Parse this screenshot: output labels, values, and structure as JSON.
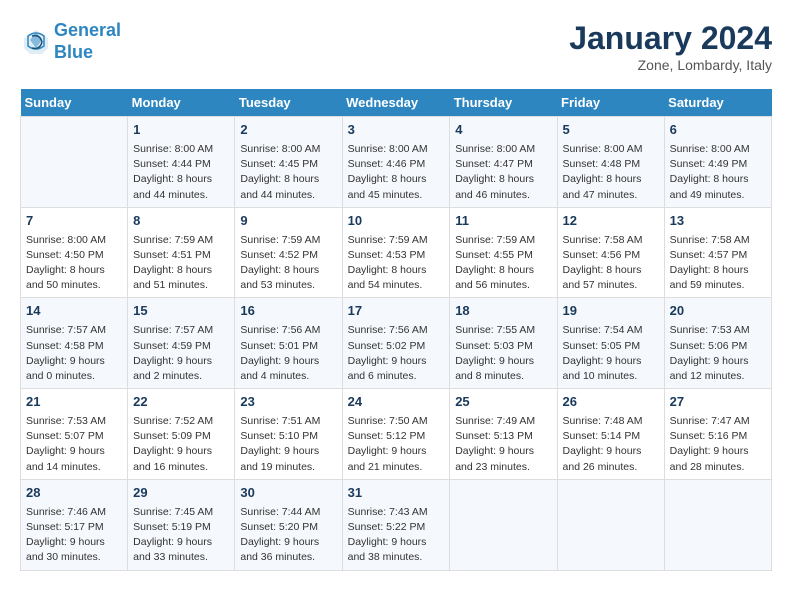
{
  "header": {
    "logo_line1": "General",
    "logo_line2": "Blue",
    "month": "January 2024",
    "location": "Zone, Lombardy, Italy"
  },
  "days_of_week": [
    "Sunday",
    "Monday",
    "Tuesday",
    "Wednesday",
    "Thursday",
    "Friday",
    "Saturday"
  ],
  "weeks": [
    [
      {
        "day": "",
        "text": ""
      },
      {
        "day": "1",
        "text": "Sunrise: 8:00 AM\nSunset: 4:44 PM\nDaylight: 8 hours\nand 44 minutes."
      },
      {
        "day": "2",
        "text": "Sunrise: 8:00 AM\nSunset: 4:45 PM\nDaylight: 8 hours\nand 44 minutes."
      },
      {
        "day": "3",
        "text": "Sunrise: 8:00 AM\nSunset: 4:46 PM\nDaylight: 8 hours\nand 45 minutes."
      },
      {
        "day": "4",
        "text": "Sunrise: 8:00 AM\nSunset: 4:47 PM\nDaylight: 8 hours\nand 46 minutes."
      },
      {
        "day": "5",
        "text": "Sunrise: 8:00 AM\nSunset: 4:48 PM\nDaylight: 8 hours\nand 47 minutes."
      },
      {
        "day": "6",
        "text": "Sunrise: 8:00 AM\nSunset: 4:49 PM\nDaylight: 8 hours\nand 49 minutes."
      }
    ],
    [
      {
        "day": "7",
        "text": "Sunrise: 8:00 AM\nSunset: 4:50 PM\nDaylight: 8 hours\nand 50 minutes."
      },
      {
        "day": "8",
        "text": "Sunrise: 7:59 AM\nSunset: 4:51 PM\nDaylight: 8 hours\nand 51 minutes."
      },
      {
        "day": "9",
        "text": "Sunrise: 7:59 AM\nSunset: 4:52 PM\nDaylight: 8 hours\nand 53 minutes."
      },
      {
        "day": "10",
        "text": "Sunrise: 7:59 AM\nSunset: 4:53 PM\nDaylight: 8 hours\nand 54 minutes."
      },
      {
        "day": "11",
        "text": "Sunrise: 7:59 AM\nSunset: 4:55 PM\nDaylight: 8 hours\nand 56 minutes."
      },
      {
        "day": "12",
        "text": "Sunrise: 7:58 AM\nSunset: 4:56 PM\nDaylight: 8 hours\nand 57 minutes."
      },
      {
        "day": "13",
        "text": "Sunrise: 7:58 AM\nSunset: 4:57 PM\nDaylight: 8 hours\nand 59 minutes."
      }
    ],
    [
      {
        "day": "14",
        "text": "Sunrise: 7:57 AM\nSunset: 4:58 PM\nDaylight: 9 hours\nand 0 minutes."
      },
      {
        "day": "15",
        "text": "Sunrise: 7:57 AM\nSunset: 4:59 PM\nDaylight: 9 hours\nand 2 minutes."
      },
      {
        "day": "16",
        "text": "Sunrise: 7:56 AM\nSunset: 5:01 PM\nDaylight: 9 hours\nand 4 minutes."
      },
      {
        "day": "17",
        "text": "Sunrise: 7:56 AM\nSunset: 5:02 PM\nDaylight: 9 hours\nand 6 minutes."
      },
      {
        "day": "18",
        "text": "Sunrise: 7:55 AM\nSunset: 5:03 PM\nDaylight: 9 hours\nand 8 minutes."
      },
      {
        "day": "19",
        "text": "Sunrise: 7:54 AM\nSunset: 5:05 PM\nDaylight: 9 hours\nand 10 minutes."
      },
      {
        "day": "20",
        "text": "Sunrise: 7:53 AM\nSunset: 5:06 PM\nDaylight: 9 hours\nand 12 minutes."
      }
    ],
    [
      {
        "day": "21",
        "text": "Sunrise: 7:53 AM\nSunset: 5:07 PM\nDaylight: 9 hours\nand 14 minutes."
      },
      {
        "day": "22",
        "text": "Sunrise: 7:52 AM\nSunset: 5:09 PM\nDaylight: 9 hours\nand 16 minutes."
      },
      {
        "day": "23",
        "text": "Sunrise: 7:51 AM\nSunset: 5:10 PM\nDaylight: 9 hours\nand 19 minutes."
      },
      {
        "day": "24",
        "text": "Sunrise: 7:50 AM\nSunset: 5:12 PM\nDaylight: 9 hours\nand 21 minutes."
      },
      {
        "day": "25",
        "text": "Sunrise: 7:49 AM\nSunset: 5:13 PM\nDaylight: 9 hours\nand 23 minutes."
      },
      {
        "day": "26",
        "text": "Sunrise: 7:48 AM\nSunset: 5:14 PM\nDaylight: 9 hours\nand 26 minutes."
      },
      {
        "day": "27",
        "text": "Sunrise: 7:47 AM\nSunset: 5:16 PM\nDaylight: 9 hours\nand 28 minutes."
      }
    ],
    [
      {
        "day": "28",
        "text": "Sunrise: 7:46 AM\nSunset: 5:17 PM\nDaylight: 9 hours\nand 30 minutes."
      },
      {
        "day": "29",
        "text": "Sunrise: 7:45 AM\nSunset: 5:19 PM\nDaylight: 9 hours\nand 33 minutes."
      },
      {
        "day": "30",
        "text": "Sunrise: 7:44 AM\nSunset: 5:20 PM\nDaylight: 9 hours\nand 36 minutes."
      },
      {
        "day": "31",
        "text": "Sunrise: 7:43 AM\nSunset: 5:22 PM\nDaylight: 9 hours\nand 38 minutes."
      },
      {
        "day": "",
        "text": ""
      },
      {
        "day": "",
        "text": ""
      },
      {
        "day": "",
        "text": ""
      }
    ]
  ]
}
